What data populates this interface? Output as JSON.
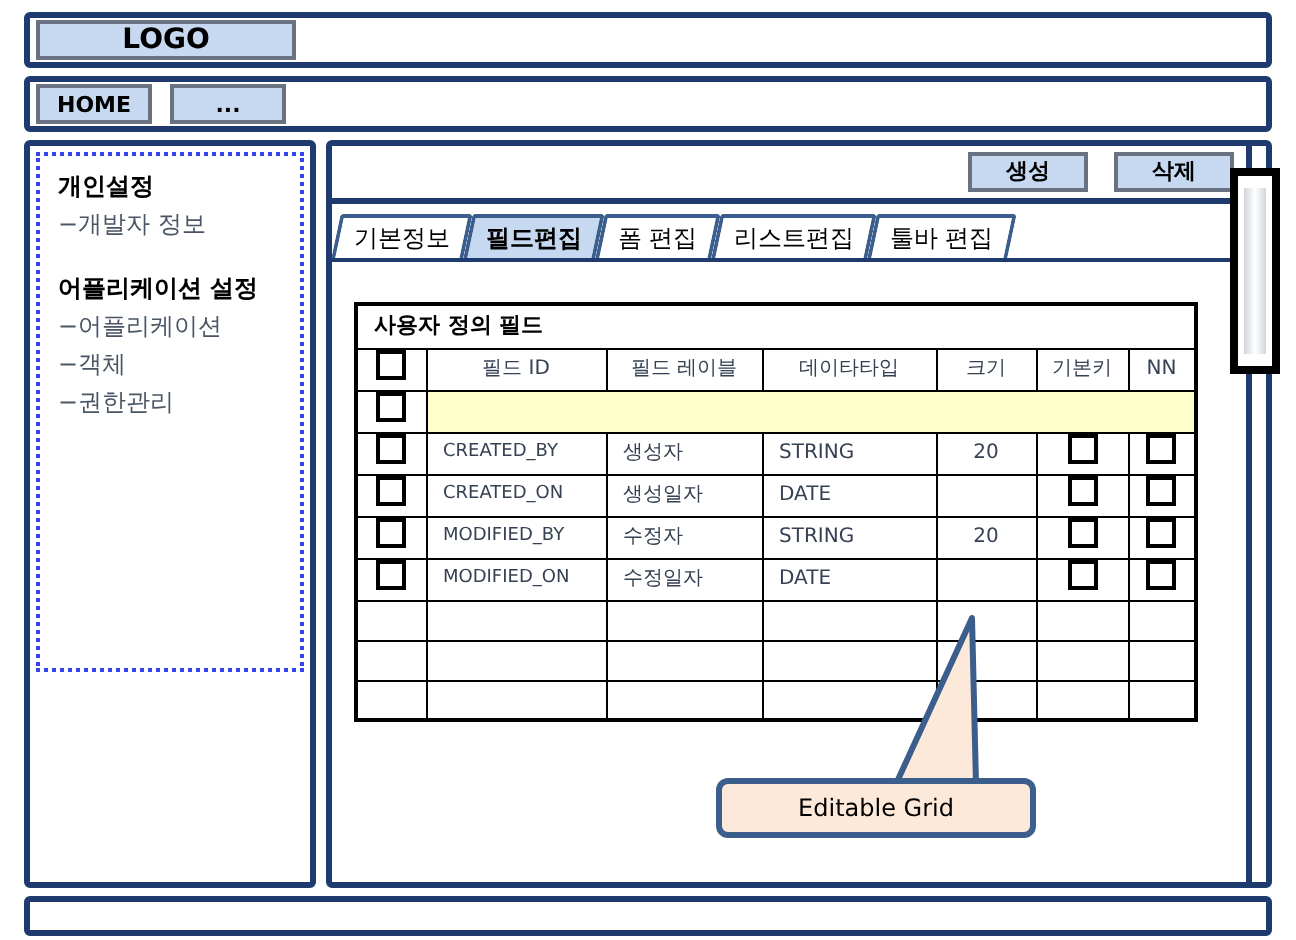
{
  "header": {
    "logo": "LOGO"
  },
  "nav": {
    "buttons": [
      "HOME",
      "..."
    ]
  },
  "sidebar": {
    "groups": [
      {
        "title": "개인설정",
        "items": [
          "−개발자 정보"
        ]
      },
      {
        "title": "어플리케이션 설정",
        "items": [
          "−어플리케이션",
          "−객체",
          "−권한관리"
        ]
      }
    ]
  },
  "actions": [
    "생성",
    "삭제"
  ],
  "tabs": [
    {
      "label": "기본정보",
      "selected": false
    },
    {
      "label": "필드편집",
      "selected": true
    },
    {
      "label": "폼 편집",
      "selected": false
    },
    {
      "label": "리스트편집",
      "selected": false
    },
    {
      "label": "툴바 편집",
      "selected": false
    }
  ],
  "table": {
    "title": "사용자 정의 필드",
    "select_all": {
      "checked": false
    },
    "columns": [
      "필드 ID",
      "필드 레이블",
      "데이타타입",
      "크기",
      "기본키",
      "NN"
    ],
    "new_row": {
      "checked": false
    },
    "rows": [
      {
        "checked": false,
        "field_id": "CREATED_BY",
        "label": "생성자",
        "type": "STRING",
        "size": "20",
        "primary_key": false,
        "not_null": false
      },
      {
        "checked": false,
        "field_id": "CREATED_ON",
        "label": "생성일자",
        "type": "DATE",
        "primary_key": false,
        "not_null": false
      },
      {
        "checked": false,
        "field_id": "MODIFIED_BY",
        "label": "수정자",
        "type": "STRING",
        "size": "20",
        "primary_key": false,
        "not_null": false
      },
      {
        "checked": false,
        "field_id": "MODIFIED_ON",
        "label": "수정일자",
        "type": "DATE",
        "primary_key": false,
        "not_null": false
      }
    ]
  },
  "callout": "Editable Grid"
}
